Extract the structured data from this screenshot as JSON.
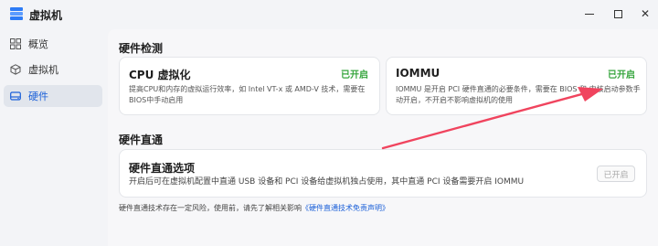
{
  "window": {
    "title": "虚拟机"
  },
  "sidebar": {
    "items": [
      {
        "label": "概览",
        "icon": "grid-icon"
      },
      {
        "label": "虚拟机",
        "icon": "cube-icon"
      },
      {
        "label": "硬件",
        "icon": "hardware-icon"
      }
    ],
    "active_index": 2
  },
  "hardware_check": {
    "title": "硬件检测",
    "cards": [
      {
        "title": "CPU 虚拟化",
        "status": "已开启",
        "desc_line1": "提高CPU和内存的虚拟运行效率，如 Intel VT-x 或 AMD-V 技术，需要在",
        "desc_line2": "BIOS中手动启用"
      },
      {
        "title": "IOMMU",
        "status": "已开启",
        "desc_line1": "IOMMU 是开启 PCI 硬件直通的必要条件，需要在 BIOS 和 内核启动参数手",
        "desc_line2": "动开启，不开启不影响虚拟机的使用"
      }
    ]
  },
  "passthrough": {
    "title": "硬件直通",
    "card": {
      "title": "硬件直通选项",
      "desc": "开启后可在虚拟机配置中直通 USB 设备和 PCI 设备给虚拟机独占使用，其中直通 PCI 设备需要开启 IOMMU",
      "button_label": "已开启"
    },
    "note_prefix": "硬件直通技术存在一定风险，使用前，请先了解相关影响",
    "note_link": "《硬件直通技术免责声明》"
  },
  "colors": {
    "accent": "#1a5fd8",
    "status_on": "#35a53c",
    "annotation_arrow": "#f0445e"
  }
}
